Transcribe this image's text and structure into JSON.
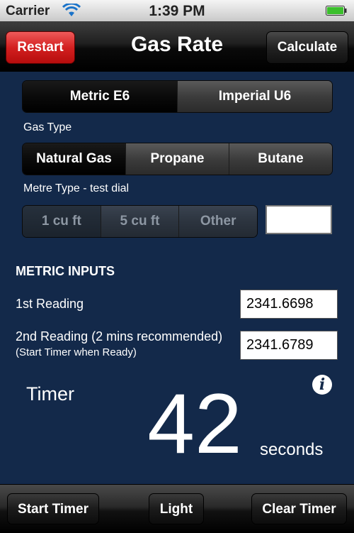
{
  "status_bar": {
    "carrier": "Carrier",
    "time": "1:39 PM"
  },
  "nav": {
    "title": "Gas Rate",
    "restart_label": "Restart",
    "calculate_label": "Calculate"
  },
  "units_segment": {
    "options": [
      "Metric E6",
      "Imperial U6"
    ],
    "selected": 0
  },
  "gas_type": {
    "label": "Gas Type",
    "options": [
      "Natural Gas",
      "Propane",
      "Butane"
    ],
    "selected": 0
  },
  "metre_type": {
    "label": "Metre Type - test dial",
    "options": [
      "1 cu ft",
      "5 cu ft",
      "Other"
    ],
    "selected": 0,
    "other_value": ""
  },
  "inputs": {
    "section_title": "METRIC INPUTS",
    "first_label": "1st Reading",
    "first_value": "2341.6698",
    "second_label": "2nd Reading (2 mins recommended)",
    "second_sublabel": "(Start Timer when Ready)",
    "second_value": "2341.6789"
  },
  "timer": {
    "label": "Timer",
    "value": "42",
    "unit": "seconds"
  },
  "toolbar": {
    "start_label": "Start Timer",
    "light_label": "Light",
    "clear_label": "Clear Timer"
  },
  "colors": {
    "background": "#13294a",
    "restart": "#d32020"
  }
}
